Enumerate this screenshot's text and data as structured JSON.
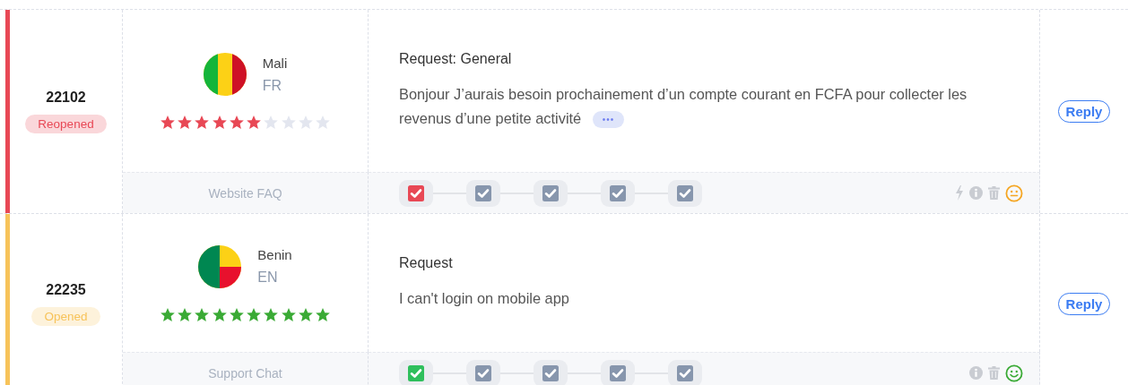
{
  "tickets": [
    {
      "id": "22102",
      "status": {
        "label": "Reopened",
        "color": "#e84855"
      },
      "country": "Mali",
      "language": "FR",
      "flag": {
        "kind": "mali"
      },
      "rating": {
        "stars": 6,
        "color": "#e84855"
      },
      "source": "Website FAQ",
      "subject": "Request: General",
      "message": "Bonjour J’aurais besoin prochainement d’un compte courant en FCFA pour collecter les revenus d’une petite activité",
      "more": "•••",
      "steps": [
        {
          "color": "#e84855"
        },
        {
          "color": "#8796ad"
        },
        {
          "color": "#8796ad"
        },
        {
          "color": "#8796ad"
        },
        {
          "color": "#8796ad"
        }
      ],
      "actions": [
        {
          "kind": "bolt"
        },
        {
          "kind": "info"
        },
        {
          "kind": "trash"
        }
      ],
      "mood": {
        "kind": "neutral",
        "color": "#f5a623"
      },
      "reply": "Reply"
    },
    {
      "id": "22235",
      "status": {
        "label": "Opened",
        "color": "#f7c35a"
      },
      "country": "Benin",
      "language": "EN",
      "flag": {
        "kind": "benin"
      },
      "rating": {
        "stars": 10,
        "color": "#3aaa35"
      },
      "source": "Support Chat",
      "subject": "Request",
      "message": "I can't login on mobile app",
      "steps": [
        {
          "color": "#2fbf5c"
        },
        {
          "color": "#8796ad"
        },
        {
          "color": "#8796ad"
        },
        {
          "color": "#8796ad"
        },
        {
          "color": "#8796ad"
        }
      ],
      "actions": [
        {
          "kind": "info"
        },
        {
          "kind": "trash"
        }
      ],
      "mood": {
        "kind": "happy",
        "color": "#3aaa35"
      },
      "reply": "Reply"
    }
  ]
}
